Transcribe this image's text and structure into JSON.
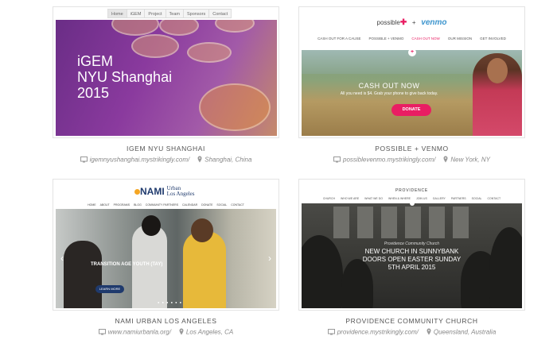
{
  "cards": [
    {
      "title": "IGEM NYU SHANGHAI",
      "url": "igemnyushanghai.mystrikingly.com/",
      "location": "Shanghai, China",
      "preview": {
        "nav": [
          "Home",
          "iGEM",
          "Project",
          "Team",
          "Sponsors",
          "Contact"
        ],
        "hero_lines": [
          "iGEM",
          "NYU Shanghai",
          "2015"
        ]
      }
    },
    {
      "title": "POSSIBLE + VENMO",
      "url": "possiblevenmo.mystrikingly.com/",
      "location": "New York, NY",
      "preview": {
        "logo_left": "possible",
        "logo_plus": "+",
        "logo_right": "venmo",
        "nav": [
          "CASH OUT FOR A CAUSE",
          "POSSIBLE + VENMO",
          "CASH OUT NOW",
          "OUR MISSION",
          "GET INVOLVED"
        ],
        "hero_title": "CASH OUT NOW",
        "hero_subtitle": "All you need is $4. Grab your phone to give back today.",
        "donate_label": "DONATE"
      }
    },
    {
      "title": "NAMI URBAN LOS ANGELES",
      "url": "www.namiurbanla.org/",
      "location": "Los Angeles, CA",
      "preview": {
        "logo_mark": "NAMI",
        "logo_text_1": "Urban",
        "logo_text_2": "Los Angeles",
        "nav": [
          "HOME",
          "ABOUT",
          "PROGRAMS",
          "BLOG",
          "COMMUNITY PARTNERS",
          "CALENDAR",
          "DONATE",
          "SOCIAL",
          "CONTACT"
        ],
        "hero_title": "TRANSITION AGE YOUTH (TAY)",
        "button_label": "LEARN MORE"
      }
    },
    {
      "title": "PROVIDENCE COMMUNITY CHURCH",
      "url": "providence.mystrikingly.com/",
      "location": "Queensland, Australia",
      "preview": {
        "logo": "PROVIDENCE",
        "nav": [
          "CHURCH",
          "WHO WE ARE",
          "WHAT WE DO",
          "WHEN & WHERE",
          "JOIN US",
          "GALLERY",
          "PARTNERS",
          "SOCIAL",
          "CONTACT"
        ],
        "hero_small": "Providence Community Church",
        "hero_lines": [
          "NEW CHURCH IN SUNNYBANK",
          "DOORS OPEN EASTER SUNDAY",
          "5TH APRIL 2015"
        ]
      }
    }
  ],
  "icons": {
    "url": "monitor-icon",
    "location": "map-pin-icon"
  },
  "colors": {
    "accent_pink": "#e91e63",
    "venmo_blue": "#3d95ce",
    "nami_navy": "#1f3a6d"
  }
}
